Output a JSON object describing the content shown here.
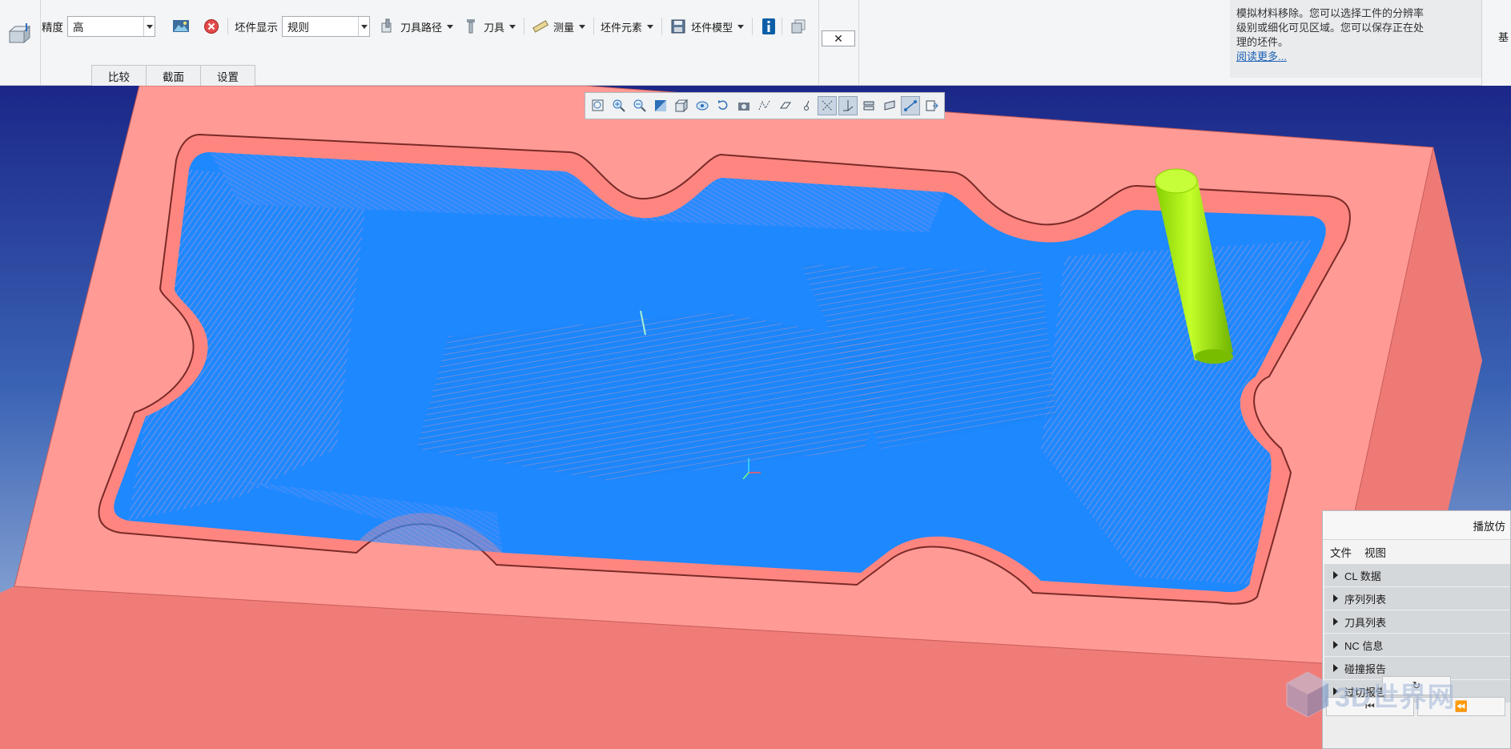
{
  "ribbon": {
    "precision_label": "精度",
    "precision_value": "高",
    "workpiece_display_label": "坯件显示",
    "workpiece_display_value": "规则",
    "toolpath_label": "刀具路径",
    "tool_label": "刀具",
    "measure_label": "测量",
    "workpiece_element_label": "坯件元素",
    "workpiece_model_label": "坯件模型",
    "subtabs": [
      "比较",
      "截面",
      "设置"
    ],
    "close_label": "✕"
  },
  "info_panel": {
    "line1": "模拟材料移除。您可以选择工件的分辨率",
    "line2": "级别或细化可见区域。您可以保存正在处",
    "line3": "理的坯件。",
    "more_link": "阅读更多..."
  },
  "right_strip": {
    "text": "基"
  },
  "view_toolbar": {
    "icons": [
      "zoom-fit-icon",
      "zoom-in-icon",
      "zoom-out-icon",
      "shaded-icon",
      "cube-view-icon",
      "saved-views-icon",
      "rotate-icon",
      "snapshot-icon",
      "toolpath-display-icon",
      "csys-icon",
      "point-icon",
      "axis-display-icon",
      "plane-display-icon",
      "layer-icon",
      "section-icon",
      "trajectory-icon",
      "export-icon"
    ]
  },
  "play_panel": {
    "title": "播放仿",
    "menu": [
      "文件",
      "视图"
    ],
    "sections": [
      "CL 数据",
      "序列列表",
      "刀具列表",
      "NC 信息",
      "碰撞报告",
      "过切报告"
    ],
    "rotate_glyph": "↻",
    "rewind_glyph": "⏮",
    "back_glyph": "⏪"
  },
  "watermark": {
    "text": "3D世界网"
  },
  "colors": {
    "block_top": "#ff9a95",
    "block_side": "#f07c78",
    "toolpath": "#1e88ff",
    "tool": "#a5f000",
    "background_top": "#1b2788"
  }
}
